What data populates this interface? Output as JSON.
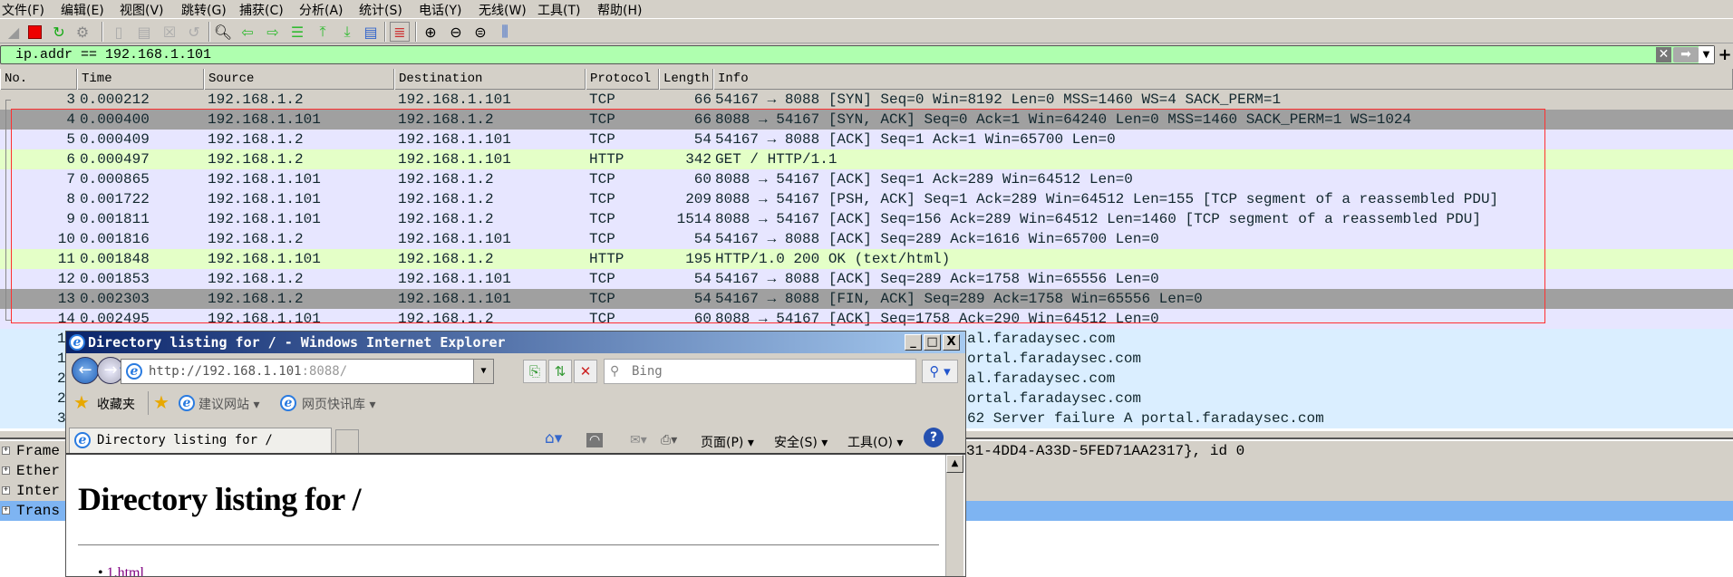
{
  "menu": [
    "文件(F)",
    "编辑(E)",
    "视图(V)",
    "跳转(G)",
    "捕获(C)",
    "分析(A)",
    "统计(S)",
    "电话(Y)",
    "无线(W)",
    "工具(T)",
    "帮助(H)"
  ],
  "filter": {
    "value": "ip.addr == 192.168.1.101",
    "add": "+"
  },
  "columns": [
    "No.",
    "Time",
    "Source",
    "Destination",
    "Protocol",
    "Length",
    "Info"
  ],
  "colors": {
    "tcp": "#e7e6ff",
    "http": "#e4ffc7",
    "dns": "#daeeff",
    "marked": "#a0a0a0",
    "first": "#d4d0c8",
    "filter_bg": "#afffaf",
    "highlight_box": "#ff3030",
    "detail_selected": "#7eb4f2"
  },
  "packets": [
    {
      "no": "3",
      "time": "0.000212",
      "src": "192.168.1.2",
      "dst": "192.168.1.101",
      "proto": "TCP",
      "len": "66",
      "info": "54167 → 8088 [SYN] Seq=0 Win=8192 Len=0 MSS=1460 WS=4 SACK_PERM=1",
      "style": "first"
    },
    {
      "no": "4",
      "time": "0.000400",
      "src": "192.168.1.101",
      "dst": "192.168.1.2",
      "proto": "TCP",
      "len": "66",
      "info": "8088 → 54167 [SYN, ACK] Seq=0 Ack=1 Win=64240 Len=0 MSS=1460 SACK_PERM=1 WS=1024",
      "style": "marked"
    },
    {
      "no": "5",
      "time": "0.000409",
      "src": "192.168.1.2",
      "dst": "192.168.1.101",
      "proto": "TCP",
      "len": "54",
      "info": "54167 → 8088 [ACK] Seq=1 Ack=1 Win=65700 Len=0",
      "style": "tcp"
    },
    {
      "no": "6",
      "time": "0.000497",
      "src": "192.168.1.2",
      "dst": "192.168.1.101",
      "proto": "HTTP",
      "len": "342",
      "info": "GET / HTTP/1.1",
      "style": "http"
    },
    {
      "no": "7",
      "time": "0.000865",
      "src": "192.168.1.101",
      "dst": "192.168.1.2",
      "proto": "TCP",
      "len": "60",
      "info": "8088 → 54167 [ACK] Seq=1 Ack=289 Win=64512 Len=0",
      "style": "tcp"
    },
    {
      "no": "8",
      "time": "0.001722",
      "src": "192.168.1.101",
      "dst": "192.168.1.2",
      "proto": "TCP",
      "len": "209",
      "info": "8088 → 54167 [PSH, ACK] Seq=1 Ack=289 Win=64512 Len=155 [TCP segment of a reassembled PDU]",
      "style": "tcp"
    },
    {
      "no": "9",
      "time": "0.001811",
      "src": "192.168.1.101",
      "dst": "192.168.1.2",
      "proto": "TCP",
      "len": "1514",
      "info": "8088 → 54167 [ACK] Seq=156 Ack=289 Win=64512 Len=1460 [TCP segment of a reassembled PDU]",
      "style": "tcp"
    },
    {
      "no": "10",
      "time": "0.001816",
      "src": "192.168.1.2",
      "dst": "192.168.1.101",
      "proto": "TCP",
      "len": "54",
      "info": "54167 → 8088 [ACK] Seq=289 Ack=1616 Win=65700 Len=0",
      "style": "tcp"
    },
    {
      "no": "11",
      "time": "0.001848",
      "src": "192.168.1.101",
      "dst": "192.168.1.2",
      "proto": "HTTP",
      "len": "195",
      "info": "HTTP/1.0 200 OK  (text/html)",
      "style": "http"
    },
    {
      "no": "12",
      "time": "0.001853",
      "src": "192.168.1.2",
      "dst": "192.168.1.101",
      "proto": "TCP",
      "len": "54",
      "info": "54167 → 8088 [ACK] Seq=289 Ack=1758 Win=65556 Len=0",
      "style": "tcp"
    },
    {
      "no": "13",
      "time": "0.002303",
      "src": "192.168.1.2",
      "dst": "192.168.1.101",
      "proto": "TCP",
      "len": "54",
      "info": "54167 → 8088 [FIN, ACK] Seq=289 Ack=1758 Win=65556 Len=0",
      "style": "marked"
    },
    {
      "no": "14",
      "time": "0.002495",
      "src": "192.168.1.101",
      "dst": "192.168.1.2",
      "proto": "TCP",
      "len": "60",
      "info": "8088 → 54167 [ACK] Seq=1758 Ack=290 Win=64512 Len=0",
      "style": "tcp"
    }
  ],
  "partial_packets": [
    {
      "no": "1",
      "info": "al.faradaysec.com"
    },
    {
      "no": "1",
      "info": "ortal.faradaysec.com"
    },
    {
      "no": "2",
      "info": "al.faradaysec.com"
    },
    {
      "no": "2",
      "info": "ortal.faradaysec.com"
    },
    {
      "no": "3",
      "info": "62 Server failure A portal.faradaysec.com"
    }
  ],
  "details": [
    {
      "label": "Frame",
      "tail": "31-4DD4-A33D-5FED71AA2317}, id 0"
    },
    {
      "label": "Ether",
      "tail": ""
    },
    {
      "label": "Inter",
      "tail": ""
    },
    {
      "label": "Trans",
      "tail": ""
    }
  ],
  "ie": {
    "title": "Directory listing for / - Windows Internet Explorer",
    "address_host": "http://192.168.1.101",
    "address_port": ":8088/",
    "search_placeholder": "Bing",
    "favorites": "收藏夹",
    "suggested_sites": "建议网站 ▾",
    "web_slice": "网页快讯库 ▾",
    "tab_title": "Directory listing for /",
    "cmd_page": "页面(P) ▾",
    "cmd_safety": "安全(S) ▾",
    "cmd_tools": "工具(O) ▾",
    "heading": "Directory listing for /",
    "links": [
      "1.html"
    ]
  }
}
